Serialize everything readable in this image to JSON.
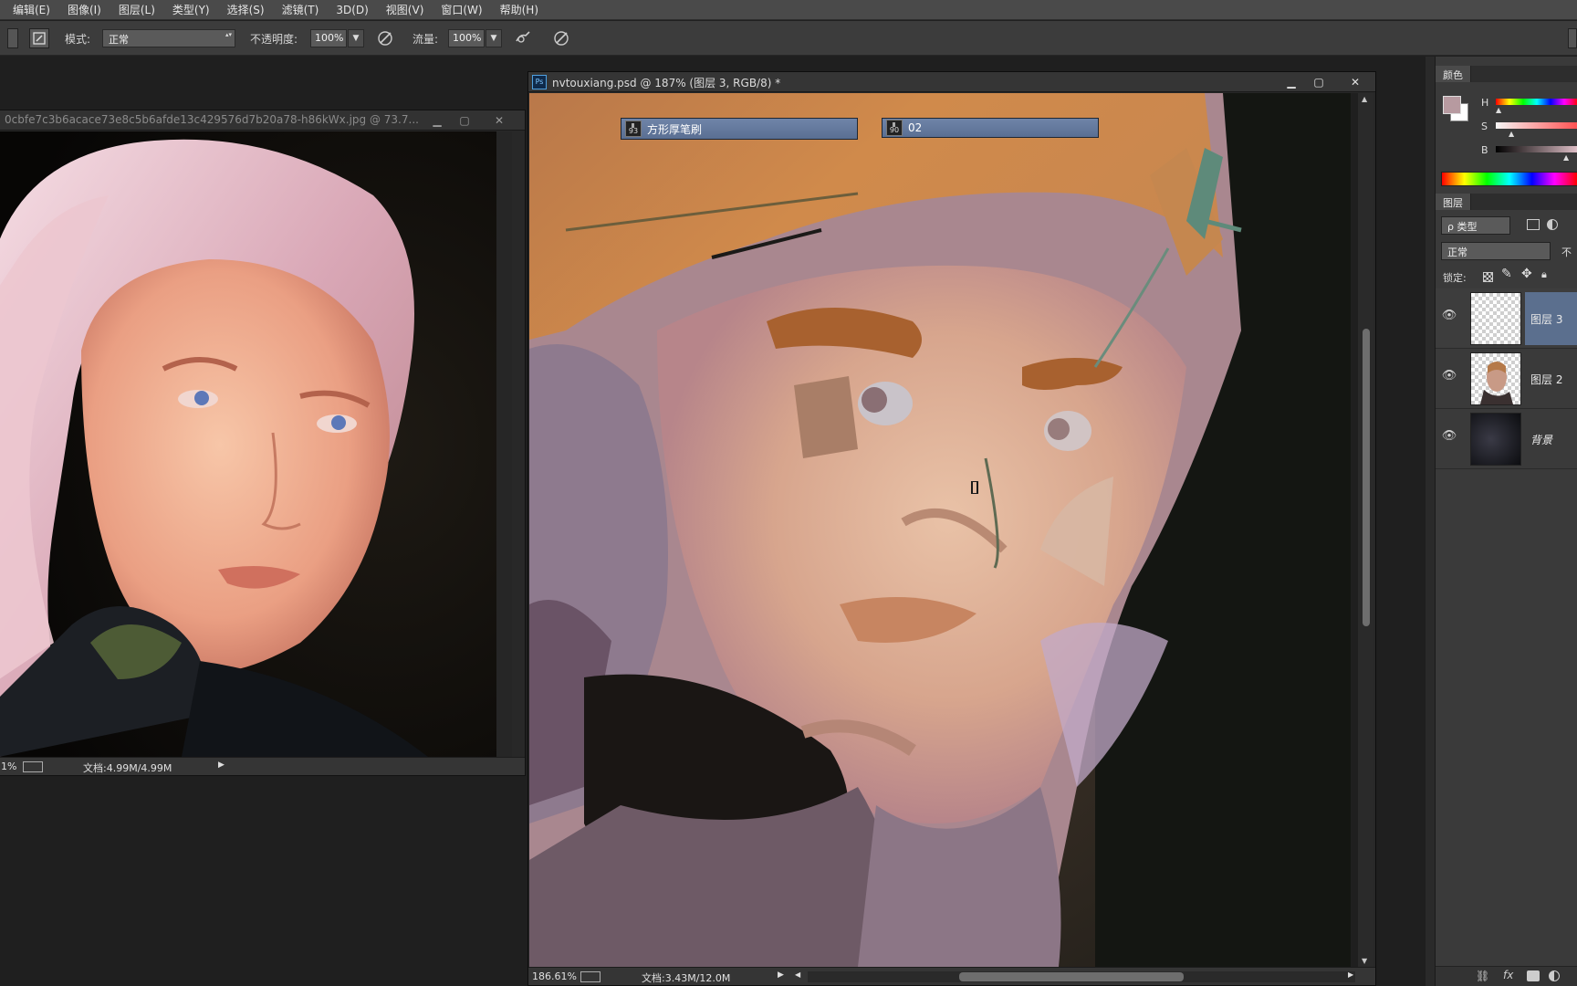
{
  "menu": [
    "编辑(E)",
    "图像(I)",
    "图层(L)",
    "类型(Y)",
    "选择(S)",
    "滤镜(T)",
    "3D(D)",
    "视图(V)",
    "窗口(W)",
    "帮助(H)"
  ],
  "options": {
    "mode_label": "模式:",
    "mode_value": "正常",
    "opacity_label": "不透明度:",
    "opacity_value": "100%",
    "flow_label": "流量:",
    "flow_value": "100%"
  },
  "reference_window": {
    "title": "0cbfe7c3b6acace73e8c5b6afde13c429576d7b20a78-h86kWx.jpg @ 73.7...",
    "zoom": "1%",
    "doc_info": "文档:4.99M/4.99M"
  },
  "main_window": {
    "app_badge": "Ps",
    "title": "nvtouxiang.psd @ 187% (图层 3, RGB/8) *",
    "zoom": "186.61%",
    "doc_info": "文档:3.43M/12.0M"
  },
  "brush_tips": [
    {
      "size": "93",
      "name": "方形厚笔刷"
    },
    {
      "size": "90",
      "name": "02"
    }
  ],
  "color_panel": {
    "tab": "颜色",
    "sliders": [
      {
        "label": "H",
        "value": 0.02
      },
      {
        "label": "S",
        "value": 0.15
      },
      {
        "label": "B",
        "value": 0.96
      }
    ],
    "foreground": "#b79aa0",
    "background": "#ffffff"
  },
  "layers_panel": {
    "tab": "图层",
    "filter_label": "ρ 类型",
    "blend_mode": "正常",
    "opacity_short": "不",
    "lock_label": "锁定:",
    "layers": [
      {
        "name": "图层 3",
        "selected": true
      },
      {
        "name": "图层 2",
        "selected": false
      },
      {
        "name": "背景",
        "selected": false
      }
    ]
  }
}
